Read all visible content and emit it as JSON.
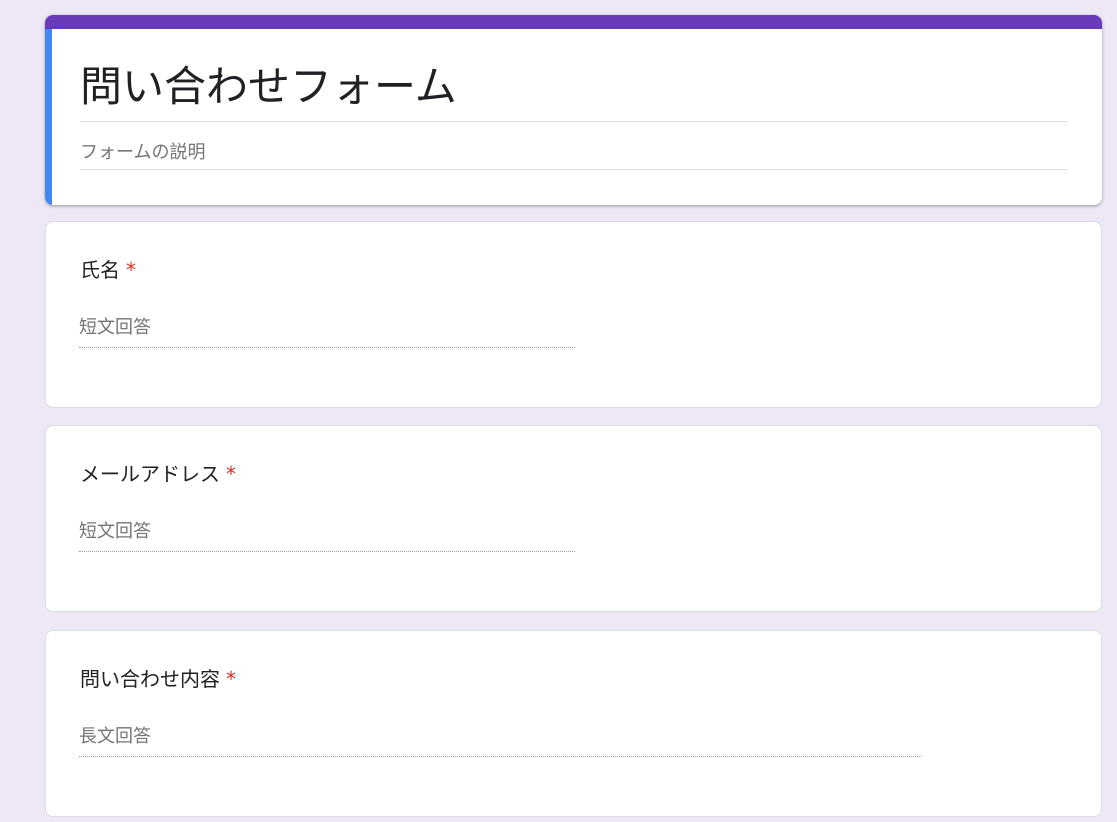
{
  "form": {
    "title": "問い合わせフォーム",
    "description": "フォームの説明"
  },
  "questions": [
    {
      "label": "氏名",
      "required_mark": "*",
      "answer_placeholder": "短文回答"
    },
    {
      "label": "メールアドレス",
      "required_mark": "*",
      "answer_placeholder": "短文回答"
    },
    {
      "label": "問い合わせ内容",
      "required_mark": "*",
      "answer_placeholder": "長文回答"
    }
  ],
  "colors": {
    "background": "#ede7f6",
    "header_accent": "#673ab7",
    "focus_accent": "#4285f4",
    "required": "#d93025"
  }
}
